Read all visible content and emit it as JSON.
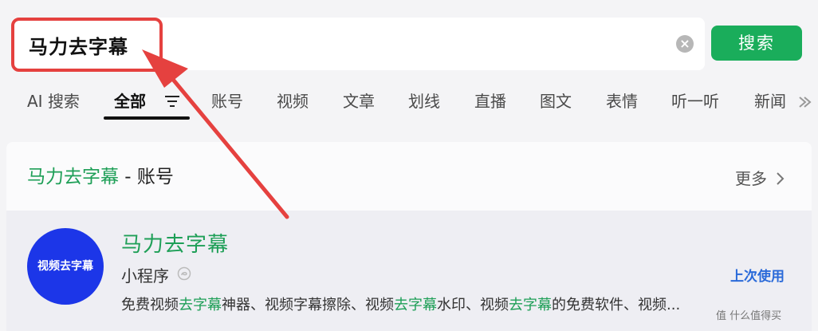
{
  "search": {
    "query": "马力去字幕",
    "button_label": "搜索",
    "clear_icon": "clear-icon",
    "clear_glyph": "×"
  },
  "tabs": [
    {
      "label": "AI 搜索"
    },
    {
      "label": "全部"
    },
    {
      "label": "账号"
    },
    {
      "label": "视频"
    },
    {
      "label": "文章"
    },
    {
      "label": "划线"
    },
    {
      "label": "直播"
    },
    {
      "label": "图文"
    },
    {
      "label": "表情"
    },
    {
      "label": "听一听"
    },
    {
      "label": "新闻"
    }
  ],
  "section": {
    "title_highlight": "马力去字幕",
    "title_suffix": " - 账号",
    "more_label": "更多"
  },
  "result": {
    "avatar_text": "视频去字幕",
    "title": "马力去字幕",
    "type": "小程序",
    "recent_label": "上次使用",
    "desc_parts": [
      {
        "text": "免费视频",
        "hl": false
      },
      {
        "text": "去字幕",
        "hl": true
      },
      {
        "text": "神器、视频字幕擦除、视频",
        "hl": false
      },
      {
        "text": "去字幕",
        "hl": true
      },
      {
        "text": "水印、视频",
        "hl": false
      },
      {
        "text": "去字幕",
        "hl": true
      },
      {
        "text": "的免费软件、视频...",
        "hl": false
      }
    ]
  },
  "watermark": "值 什么值得买",
  "colors": {
    "accent_green": "#1aad5b",
    "highlight_red": "#e5413f",
    "link_blue": "#2a6ad9",
    "avatar_blue": "#1c36e8"
  }
}
